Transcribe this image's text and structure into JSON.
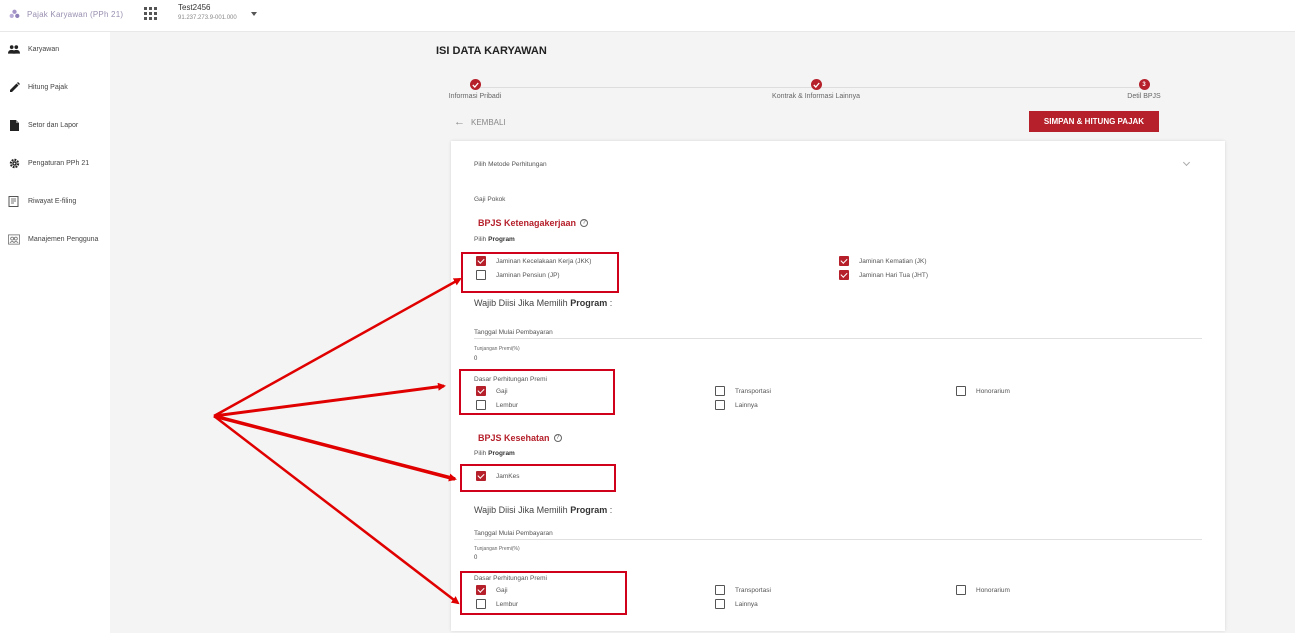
{
  "topbar": {
    "brand_title": "Pajak Karyawan (PPh 21)",
    "company_name": "Test2456",
    "company_npwp": "91.237.273.9-001.000"
  },
  "sidebar": {
    "items": [
      {
        "label": "Karyawan",
        "icon": "people-icon"
      },
      {
        "label": "Hitung Pajak",
        "icon": "pencil-icon"
      },
      {
        "label": "Setor dan Lapor",
        "icon": "document-icon"
      },
      {
        "label": "Pengaturan PPh 21",
        "icon": "gear-icon"
      },
      {
        "label": "Riwayat E-filing",
        "icon": "receipt-icon"
      },
      {
        "label": "Manajemen Pengguna",
        "icon": "users-manage-icon"
      }
    ]
  },
  "page": {
    "title": "ISI DATA KARYAWAN",
    "back_label": "KEMBALI",
    "save_label": "SIMPAN & HITUNG PAJAK"
  },
  "stepper": {
    "steps": [
      {
        "label": "Informasi Pribadi",
        "status": "done"
      },
      {
        "label": "Kontrak & Informasi Lainnya",
        "status": "done"
      },
      {
        "label": "Detil BPJS",
        "status": "active",
        "number": "3"
      }
    ]
  },
  "form": {
    "metode_label": "Pilih Metode Perhitungan",
    "gaji_pokok_label": "Gaji Pokok",
    "ketenagakerjaan": {
      "title": "BPJS Ketenagakerjaan",
      "pilih_prefix": "Pilih",
      "pilih_bold": "Program",
      "programs": [
        {
          "label": "Jaminan Kecelakaan Kerja (JKK)",
          "checked": true
        },
        {
          "label": "Jaminan Pensiun (JP)",
          "checked": false
        },
        {
          "label": "Jaminan Kematian (JK)",
          "checked": true
        },
        {
          "label": "Jaminan Hari Tua (JHT)",
          "checked": true
        }
      ],
      "wajib_prefix": "Wajib Diisi Jika Memilih",
      "wajib_bold": "Program",
      "wajib_suffix": ":",
      "tanggal_label": "Tanggal Mulai Pembayaran",
      "tunjangan_label": "Tunjangan Premi(%)",
      "tunjangan_value": "0",
      "dasar_label": "Dasar Perhitungan Premi",
      "dasar_options": [
        {
          "label": "Gaji",
          "checked": true
        },
        {
          "label": "Lembur",
          "checked": false
        },
        {
          "label": "Transportasi",
          "checked": false
        },
        {
          "label": "Lainnya",
          "checked": false
        },
        {
          "label": "Honorarium",
          "checked": false
        }
      ]
    },
    "kesehatan": {
      "title": "BPJS Kesehatan",
      "pilih_prefix": "Pilih",
      "pilih_bold": "Program",
      "programs": [
        {
          "label": "JamKes",
          "checked": true
        }
      ],
      "wajib_prefix": "Wajib Diisi Jika Memilih",
      "wajib_bold": "Program",
      "wajib_suffix": ":",
      "tanggal_label": "Tanggal Mulai Pembayaran",
      "tunjangan_label": "Tunjangan Premi(%)",
      "tunjangan_value": "0",
      "dasar_label": "Dasar Perhitungan Premi",
      "dasar_options": [
        {
          "label": "Gaji",
          "checked": true
        },
        {
          "label": "Lembur",
          "checked": false
        },
        {
          "label": "Transportasi",
          "checked": false
        },
        {
          "label": "Lainnya",
          "checked": false
        },
        {
          "label": "Honorarium",
          "checked": false
        }
      ]
    }
  },
  "colors": {
    "accent": "#b5202b",
    "annotation": "#d0021b"
  }
}
